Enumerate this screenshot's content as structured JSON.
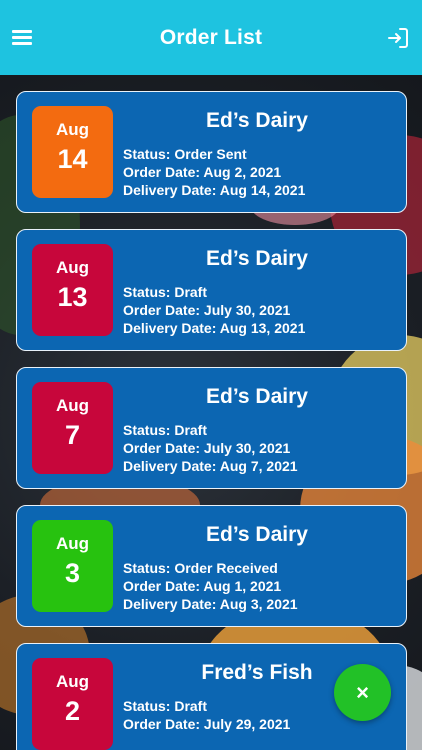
{
  "header": {
    "title": "Order List",
    "menu_icon": "hamburger-menu-icon",
    "logout_icon": "logout-icon"
  },
  "colors": {
    "header": "#1ec3e0",
    "card": "#0c66b2",
    "orange": "#f36b10",
    "red": "#c7063b",
    "green": "#27c20f",
    "fab": "#22c127"
  },
  "orders": [
    {
      "month": "Aug",
      "day": "14",
      "color": "#f36b10",
      "vendor": "Ed’s Dairy",
      "status": "Status: Order Sent",
      "order_date": "Order Date: Aug 2, 2021",
      "delivery_date": "Delivery Date: Aug 14, 2021"
    },
    {
      "month": "Aug",
      "day": "13",
      "color": "#c7063b",
      "vendor": "Ed’s Dairy",
      "status": "Status: Draft",
      "order_date": "Order Date: July 30, 2021",
      "delivery_date": "Delivery Date: Aug 13, 2021"
    },
    {
      "month": "Aug",
      "day": "7",
      "color": "#c7063b",
      "vendor": "Ed’s Dairy",
      "status": "Status: Draft",
      "order_date": "Order Date: July 30, 2021",
      "delivery_date": "Delivery Date: Aug 7, 2021"
    },
    {
      "month": "Aug",
      "day": "3",
      "color": "#27c20f",
      "vendor": "Ed’s Dairy",
      "status": "Status: Order Received",
      "order_date": "Order Date: Aug 1, 2021",
      "delivery_date": "Delivery Date: Aug 3, 2021"
    },
    {
      "month": "Aug",
      "day": "2",
      "color": "#c7063b",
      "vendor": "Fred’s Fish",
      "status": "Status: Draft",
      "order_date": "Order Date: July 29, 2021",
      "delivery_date": ""
    }
  ],
  "fab": {
    "label": "×",
    "icon": "close-icon"
  }
}
